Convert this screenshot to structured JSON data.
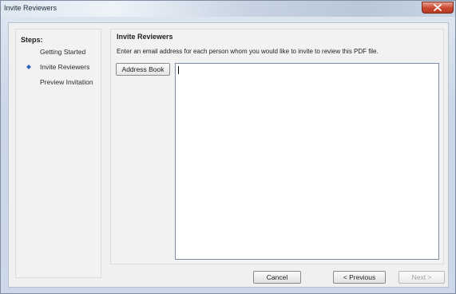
{
  "window": {
    "title": "Invite Reviewers"
  },
  "steps": {
    "heading": "Steps:",
    "items": [
      {
        "label": "Getting Started",
        "active": false
      },
      {
        "label": "Invite Reviewers",
        "active": true
      },
      {
        "label": "Preview Invitation",
        "active": false
      }
    ],
    "active_marker_color": "#2e63b5"
  },
  "main": {
    "heading": "Invite Reviewers",
    "instructions": "Enter an email address for each person whom you would like to invite to review this PDF file.",
    "address_book_label": "Address Book",
    "email_value": ""
  },
  "footer": {
    "cancel_label": "Cancel",
    "previous_label": "< Previous",
    "next_label": "Next >",
    "next_enabled": false
  }
}
